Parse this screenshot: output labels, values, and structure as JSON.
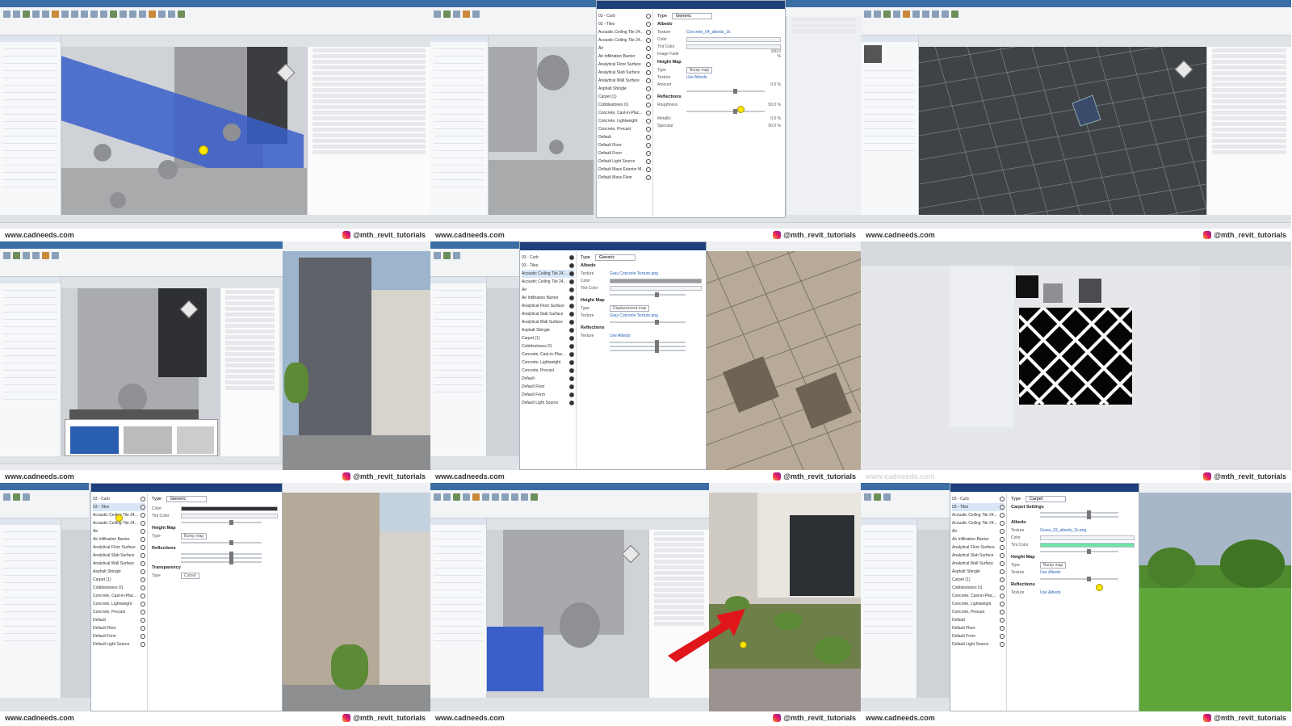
{
  "watermark": {
    "site": "www.cadneeds.com",
    "instagram": "@mth_revit_tutorials"
  },
  "tiles": [
    {
      "id": "t1",
      "kind": "revit-3d-blue",
      "view_tab": "3D"
    },
    {
      "id": "t2",
      "kind": "material-editor",
      "type_label": "Type",
      "type_value": "Generic",
      "materials_label": "Materials",
      "sections": [
        "Albedo",
        "Height Map",
        "Reflections"
      ],
      "albedo_texture": "Concrete_04_albedo_1k",
      "heightmap_type": "Bump map",
      "use_albedo": "Use Albedo",
      "values": [
        "100.0 %",
        "0.0 %",
        "50.0 %",
        "0.0 %",
        "50.0 %"
      ]
    },
    {
      "id": "t3",
      "kind": "revit-3d-floor"
    },
    {
      "id": "t4",
      "kind": "revit-render-split"
    },
    {
      "id": "t5",
      "kind": "material-editor-render",
      "type_value": "Generic",
      "sections": [
        "Albedo",
        "Height Map",
        "Reflections"
      ],
      "albedo_texture": "Gray Concrete Texture.png",
      "heightmap_type": "Displacement map",
      "use_albedo": "Use Albedo"
    },
    {
      "id": "t6",
      "kind": "pattern-preview"
    },
    {
      "id": "t7",
      "kind": "material-editor-render-2",
      "type_value": "Generic",
      "sections": [
        "Height Map",
        "Reflections",
        "Transparency"
      ],
      "heightmap_type": "Bump map",
      "transparency_type": "Cutout"
    },
    {
      "id": "t8",
      "kind": "revit-3d-render-arrow"
    },
    {
      "id": "t9",
      "kind": "carpet-editor",
      "type_value": "Carpet",
      "sections": [
        "Carpet Settings",
        "Albedo",
        "Height Map",
        "Reflections"
      ],
      "albedo_texture": "Grass_03_albedo_1k.png",
      "heightmap_type": "Bump map",
      "use_albedo": "Use Albedo"
    }
  ],
  "material_list": [
    "03 - Curb",
    "03 - Tiles",
    "Acoustic Ceiling Tile 24...",
    "Acoustic Ceiling Tile 24...",
    "Air",
    "Air Infiltration Barrier",
    "Analytical Floor Surface",
    "Analytical Slab Surface",
    "Analytical Wall Surface",
    "Asphalt Shingle",
    "Carpet (1)",
    "Cobblestones 01",
    "Concrete, Cast-in-Plac...",
    "Concrete, Lightweight",
    "Concrete, Precast",
    "Default",
    "Default Floor",
    "Default Form",
    "Default Light Source",
    "Default Mass Exterior M...",
    "Default Mass Floor"
  ],
  "colors": {
    "revit_blue": "#3a5fc9",
    "ribbon_tab": "#3a6ea5",
    "editor_title": "#1f3f7a",
    "highlight": "#ffe600",
    "arrow": "#e0161b",
    "grass": "#5d9a36"
  }
}
